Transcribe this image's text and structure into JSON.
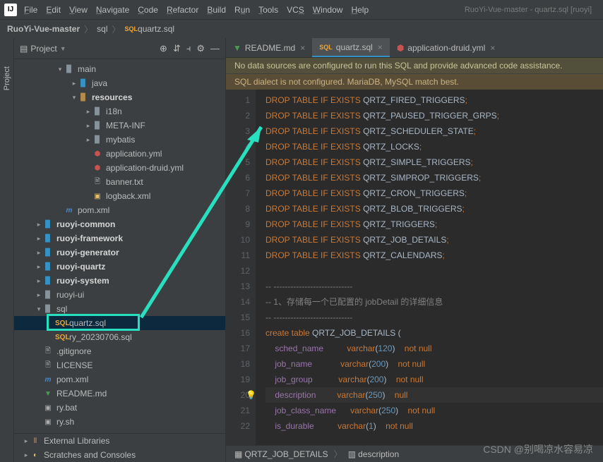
{
  "window": {
    "title": "RuoYi-Vue-master - quartz.sql [ruoyi]"
  },
  "menu": [
    "File",
    "Edit",
    "View",
    "Navigate",
    "Code",
    "Refactor",
    "Build",
    "Run",
    "Tools",
    "VCS",
    "Window",
    "Help"
  ],
  "breadcrumb": {
    "root": "RuoYi-Vue-master",
    "folder": "sql",
    "file": "quartz.sql"
  },
  "project_panel": {
    "title": "Project",
    "tree": {
      "main": "main",
      "java": "java",
      "resources": "resources",
      "i18n": "i18n",
      "metainf": "META-INF",
      "mybatis": "mybatis",
      "app_yml": "application.yml",
      "app_druid": "application-druid.yml",
      "banner": "banner.txt",
      "logback": "logback.xml",
      "pom1": "pom.xml",
      "common": "ruoyi-common",
      "framework": "ruoyi-framework",
      "generator": "ruoyi-generator",
      "quartz": "ruoyi-quartz",
      "system": "ruoyi-system",
      "ui": "ruoyi-ui",
      "sql": "sql",
      "quartz_sql": "quartz.sql",
      "ry_sql": "ry_20230706.sql",
      "gitignore": ".gitignore",
      "license": "LICENSE",
      "pom2": "pom.xml",
      "readme": "README.md",
      "rybat": "ry.bat",
      "rysh": "ry.sh",
      "ext_lib": "External Libraries",
      "scratches": "Scratches and Consoles"
    }
  },
  "tabs": [
    {
      "icon": "md",
      "label": "README.md",
      "active": false
    },
    {
      "icon": "sql",
      "label": "quartz.sql",
      "active": true
    },
    {
      "icon": "yml",
      "label": "application-druid.yml",
      "active": false
    }
  ],
  "banners": {
    "warn": "No data sources are configured to run this SQL and provide advanced code assistance.",
    "info": "SQL dialect is not configured. MariaDB, MySQL match best."
  },
  "code_lines": [
    {
      "n": 1,
      "t": "drop_fired"
    },
    {
      "n": 2,
      "t": "drop_paused"
    },
    {
      "n": 3,
      "t": "drop_sched"
    },
    {
      "n": 4,
      "t": "drop_locks"
    },
    {
      "n": 5,
      "t": "drop_simple"
    },
    {
      "n": 6,
      "t": "drop_simprop"
    },
    {
      "n": 7,
      "t": "drop_cron"
    },
    {
      "n": 8,
      "t": "drop_blob"
    },
    {
      "n": 9,
      "t": "drop_triggers"
    },
    {
      "n": 10,
      "t": "drop_job"
    },
    {
      "n": 11,
      "t": "drop_cal"
    },
    {
      "n": 12,
      "t": "blank"
    },
    {
      "n": 13,
      "t": "c1"
    },
    {
      "n": 14,
      "t": "c2"
    },
    {
      "n": 15,
      "t": "c3"
    },
    {
      "n": 16,
      "t": "create"
    },
    {
      "n": 17,
      "t": "col_sched"
    },
    {
      "n": 18,
      "t": "col_jobname"
    },
    {
      "n": 19,
      "t": "col_jobgroup"
    },
    {
      "n": 20,
      "t": "col_desc"
    },
    {
      "n": 21,
      "t": "col_class"
    },
    {
      "n": 22,
      "t": "col_durable"
    }
  ],
  "sql": {
    "drop": "DROP",
    "table": "TABLE",
    "ifexists": "IF EXISTS",
    "tables": {
      "drop_fired": "QRTZ_FIRED_TRIGGERS",
      "drop_paused": "QRTZ_PAUSED_TRIGGER_GRPS",
      "drop_sched": "QRTZ_SCHEDULER_STATE",
      "drop_locks": "QRTZ_LOCKS",
      "drop_simple": "QRTZ_SIMPLE_TRIGGERS",
      "drop_simprop": "QRTZ_SIMPROP_TRIGGERS",
      "drop_cron": "QRTZ_CRON_TRIGGERS",
      "drop_blob": "QRTZ_BLOB_TRIGGERS",
      "drop_triggers": "QRTZ_TRIGGERS",
      "drop_job": "QRTZ_JOB_DETAILS",
      "drop_cal": "QRTZ_CALENDARS"
    },
    "comments": {
      "c1": "-- ----------------------------",
      "c2": "-- 1、存储每一个已配置的 jobDetail 的详细信息",
      "c3": "-- ----------------------------"
    },
    "create_line": "create table QRTZ_JOB_DETAILS (",
    "create_kw": "create table",
    "create_tbl": "QRTZ_JOB_DETAILS",
    "cols": {
      "col_sched": {
        "name": "sched_name",
        "type": "varchar",
        "len": "120",
        "null": "not null"
      },
      "col_jobname": {
        "name": "job_name",
        "type": "varchar",
        "len": "200",
        "null": "not null"
      },
      "col_jobgroup": {
        "name": "job_group",
        "type": "varchar",
        "len": "200",
        "null": "not null"
      },
      "col_desc": {
        "name": "description",
        "type": "varchar",
        "len": "250",
        "null": "null"
      },
      "col_class": {
        "name": "job_class_name",
        "type": "varchar",
        "len": "250",
        "null": "not null"
      },
      "col_durable": {
        "name": "is_durable",
        "type": "varchar",
        "len": "1",
        "null": "not null"
      }
    }
  },
  "status": {
    "table": "QRTZ_JOB_DETAILS",
    "col": "description"
  },
  "watermark": "CSDN @别喝凉水容易凉",
  "sidetab": "Project"
}
